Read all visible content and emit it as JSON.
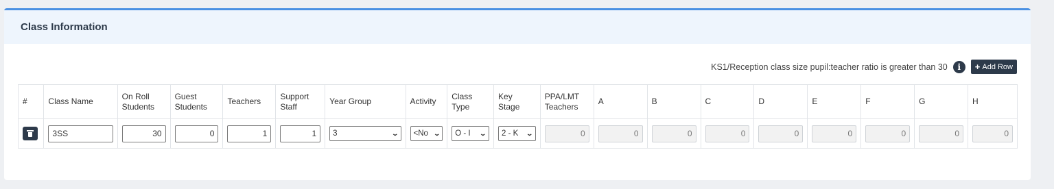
{
  "card": {
    "title": "Class Information"
  },
  "toolbar": {
    "ratio_message": "KS1/Reception class size pupil:teacher ratio is greater than 30",
    "info_glyph": "i",
    "add_row_plus": "+",
    "add_row_label": "Add Row"
  },
  "table": {
    "headers": {
      "index": "#",
      "class_name": "Class Name",
      "on_roll": "On Roll Students",
      "guest": "Guest Students",
      "teachers": "Teachers",
      "support": "Support Staff",
      "year_group": "Year Group",
      "activity": "Activity",
      "class_type": "Class Type",
      "key_stage": "Key Stage",
      "ppa": "PPA/LMT Teachers",
      "a": "A",
      "b": "B",
      "c": "C",
      "d": "D",
      "e": "E",
      "f": "F",
      "g": "G",
      "h": "H"
    },
    "row": {
      "class_name": "3SS",
      "on_roll": "30",
      "guest": "0",
      "teachers": "1",
      "support": "1",
      "year_group": "3",
      "activity": "<No",
      "class_type": "O - I",
      "key_stage": "2 - K",
      "ppa": "0",
      "a": "0",
      "b": "0",
      "c": "0",
      "d": "0",
      "e": "0",
      "f": "0",
      "g": "0",
      "h": "0"
    }
  },
  "colors": {
    "accent": "#4a90e2",
    "header_bg": "#eef5fd",
    "dark": "#2d3a4a"
  }
}
